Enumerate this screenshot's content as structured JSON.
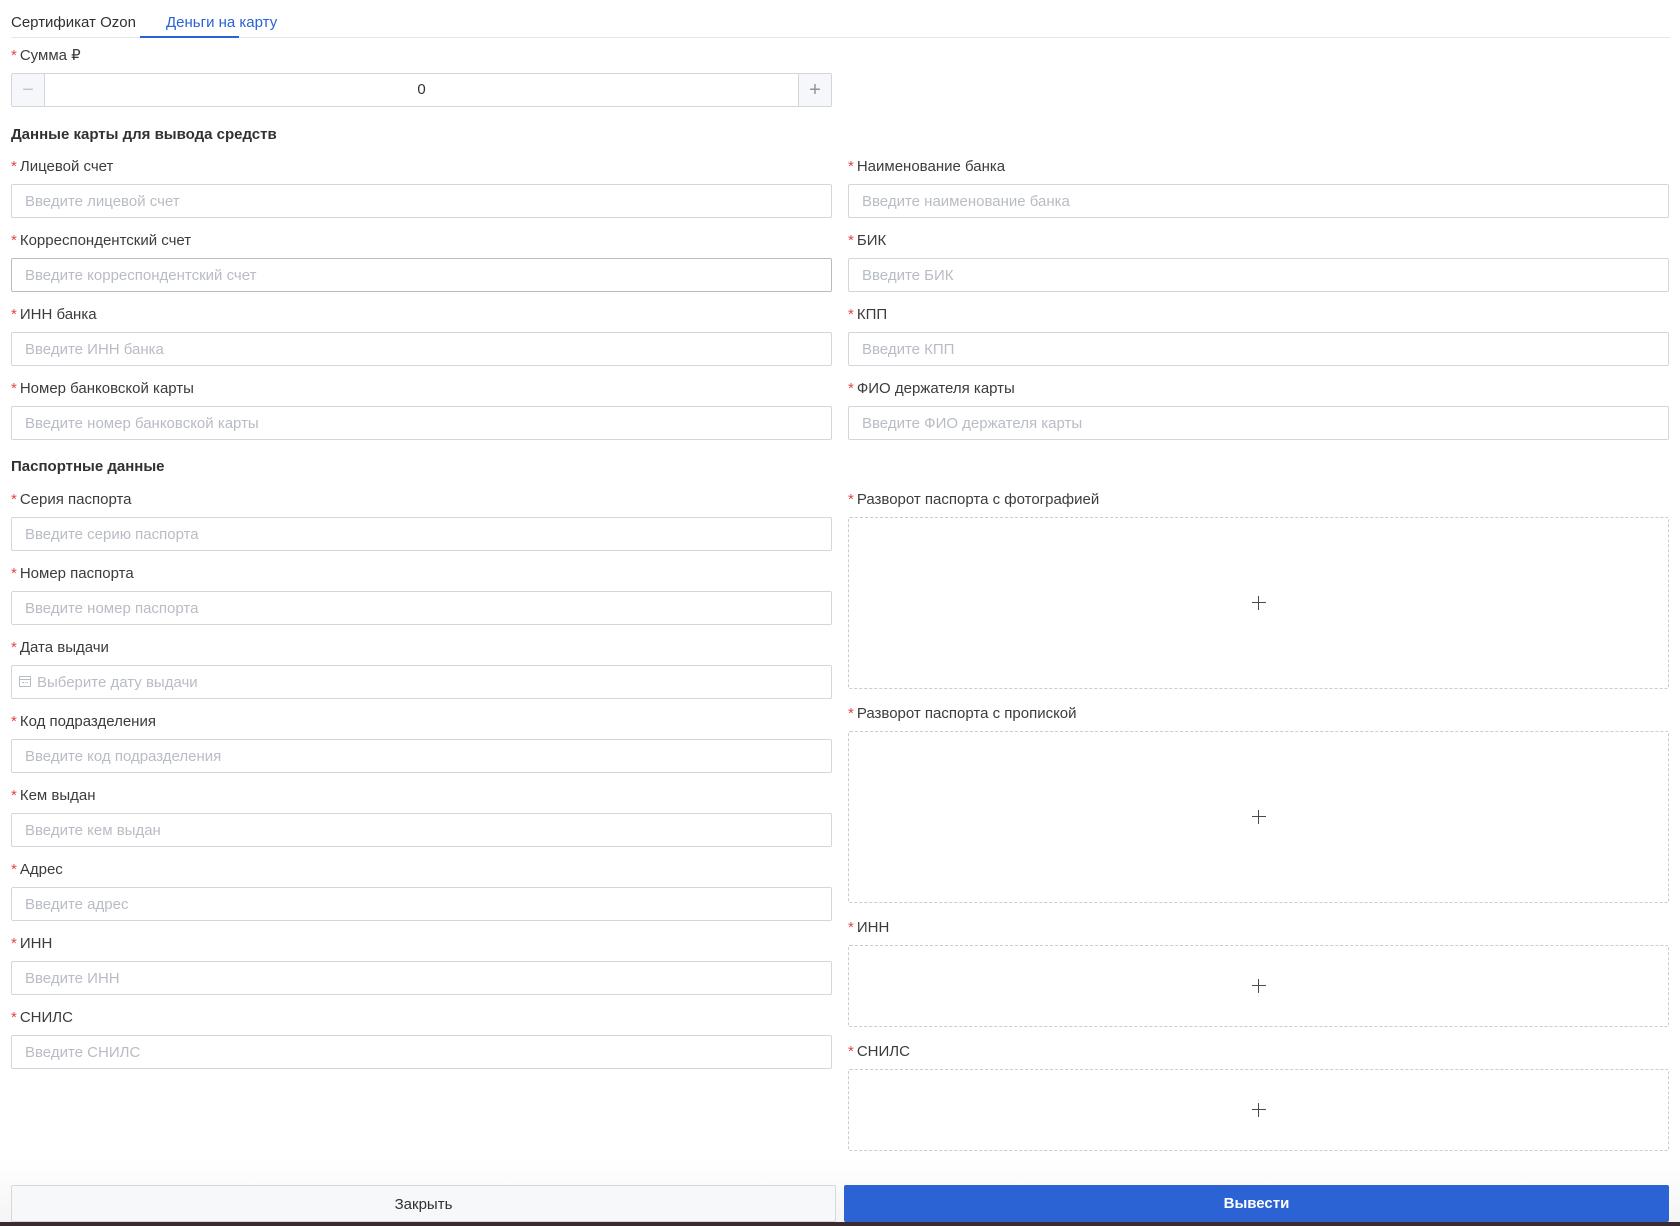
{
  "tabs": [
    {
      "label": "Сертификат Ozon",
      "active": false
    },
    {
      "label": "Деньги на карту",
      "active": true
    }
  ],
  "amount": {
    "label": "Сумма ₽",
    "value": "0",
    "minus": "−",
    "plus": "+"
  },
  "card_section": {
    "title": "Данные карты для вывода средств",
    "fields": {
      "personal_account": {
        "label": "Лицевой счет",
        "placeholder": "Введите лицевой счет"
      },
      "bank_name": {
        "label": "Наименование банка",
        "placeholder": "Введите наименование банка"
      },
      "corr_account": {
        "label": "Корреспондентский счет",
        "placeholder": "Введите корреспондентский счет"
      },
      "bik": {
        "label": "БИК",
        "placeholder": "Введите БИК"
      },
      "bank_inn": {
        "label": "ИНН банка",
        "placeholder": "Введите ИНН банка"
      },
      "kpp": {
        "label": "КПП",
        "placeholder": "Введите КПП"
      },
      "card_number": {
        "label": "Номер банковской карты",
        "placeholder": "Введите номер банковской карты"
      },
      "holder_name": {
        "label": "ФИО держателя карты",
        "placeholder": "Введите ФИО держателя карты"
      }
    }
  },
  "passport_section": {
    "title": "Паспортные данные",
    "fields": {
      "series": {
        "label": "Серия паспорта",
        "placeholder": "Введите серию паспорта"
      },
      "number": {
        "label": "Номер паспорта",
        "placeholder": "Введите номер паспорта"
      },
      "issue_date": {
        "label": "Дата выдачи",
        "placeholder": "Выберите дату выдачи"
      },
      "division_code": {
        "label": "Код подразделения",
        "placeholder": "Введите код подразделения"
      },
      "issued_by": {
        "label": "Кем выдан",
        "placeholder": "Введите кем выдан"
      },
      "address": {
        "label": "Адрес",
        "placeholder": "Введите адрес"
      },
      "inn": {
        "label": "ИНН",
        "placeholder": "Введите ИНН"
      },
      "snils": {
        "label": "СНИЛС",
        "placeholder": "Введите СНИЛС"
      }
    },
    "uploads": {
      "photo_page": {
        "label": "Разворот паспорта с фотографией"
      },
      "registration_page": {
        "label": "Разворот паспорта с пропиской"
      },
      "inn": {
        "label": "ИНН"
      },
      "snils": {
        "label": "СНИЛС"
      }
    }
  },
  "required_mark": "*",
  "footer": {
    "close_label": "Закрыть",
    "submit_label": "Вывести"
  },
  "colors": {
    "accent": "#2b62d4",
    "required": "#e0474c"
  }
}
